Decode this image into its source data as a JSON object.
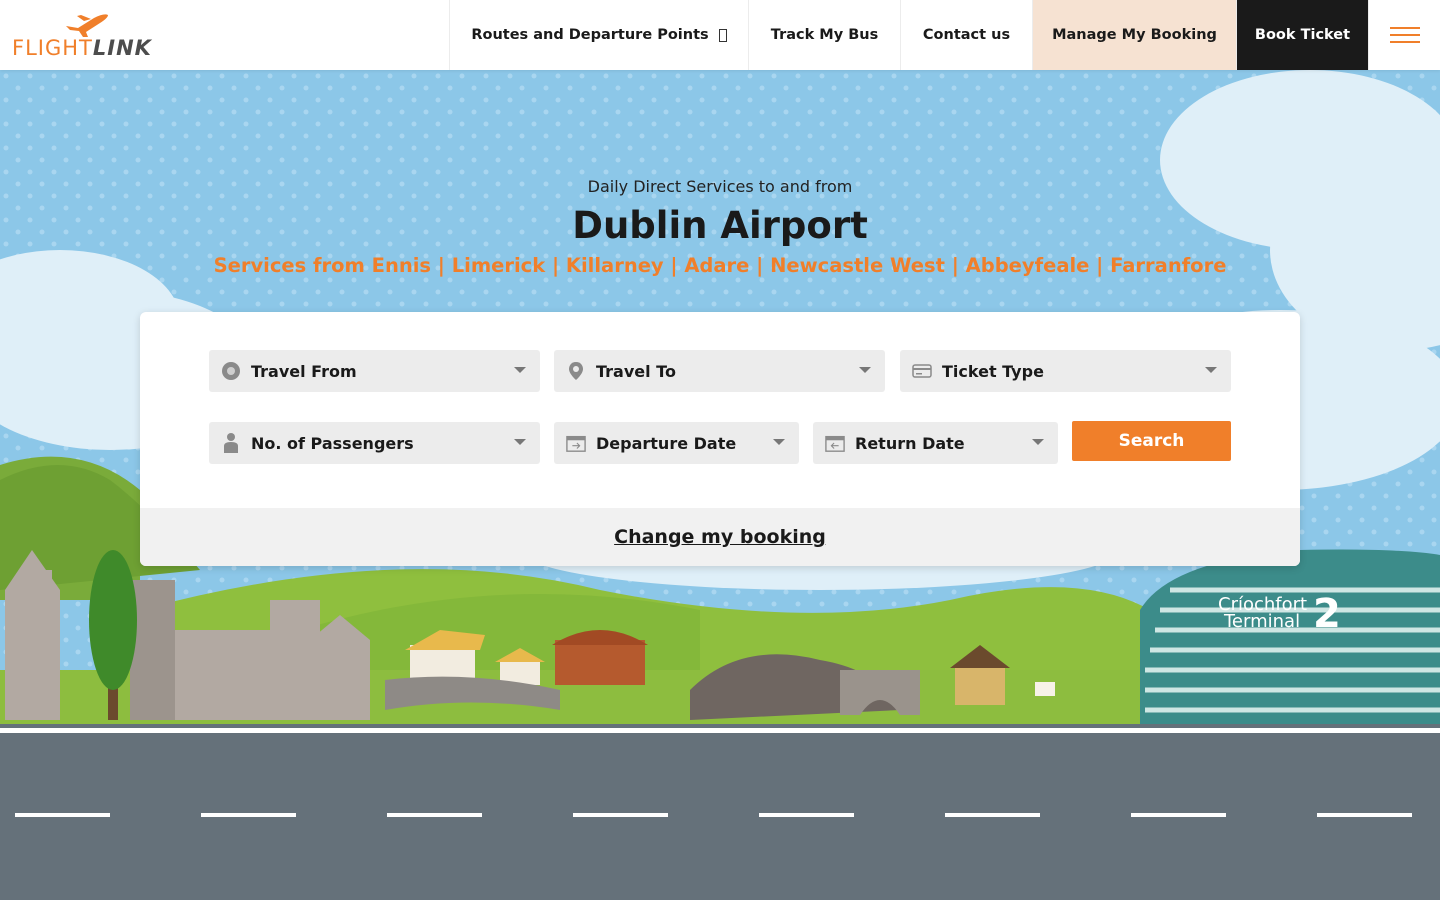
{
  "brand": {
    "flight": "FLIGHT",
    "link": "LINK",
    "color": "#f07f2a"
  },
  "nav": {
    "routes": "Routes and Departure Points",
    "track": "Track My Bus",
    "contact": "Contact us",
    "manage": "Manage My Booking",
    "book": "Book Ticket"
  },
  "hero": {
    "subtitle": "Daily Direct Services to and from",
    "title": "Dublin Airport",
    "services": "Services from Ennis | Limerick | Killarney | Adare | Newcastle West | Abbeyfeale | Farranfore"
  },
  "search": {
    "travel_from": "Travel From",
    "travel_to": "Travel To",
    "ticket_type": "Ticket Type",
    "passengers": "No. of Passengers",
    "departure_date": "Departure Date",
    "return_date": "Return Date",
    "search_label": "Search",
    "change_booking": "Change my booking"
  },
  "illustration": {
    "terminal_line1": "Críochfort",
    "terminal_line2": "Terminal",
    "terminal_number": "2"
  },
  "colors": {
    "accent": "#f07f2a",
    "dark": "#1a1a1a",
    "manage_bg": "#f6e2d2",
    "road": "#65717a"
  }
}
